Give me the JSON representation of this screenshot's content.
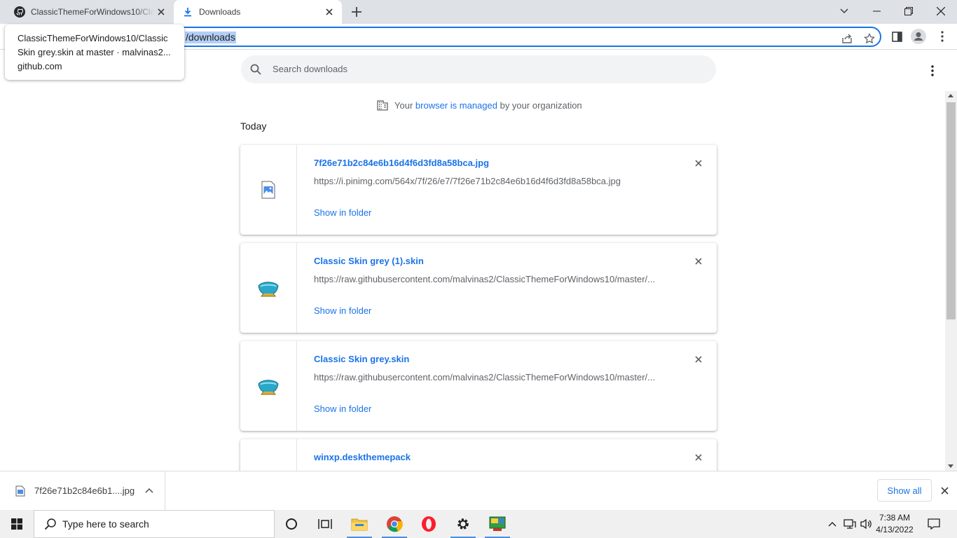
{
  "tabs": [
    {
      "title": "ClassicThemeForWindows10/Classic Skin grey.skin at master",
      "icon": "github-icon"
    },
    {
      "title": "Downloads",
      "icon": "download-icon"
    }
  ],
  "tooltip": {
    "title": "ClassicThemeForWindows10/Classic Skin grey.skin at master · malvinas2...",
    "domain": "github.com"
  },
  "omnibox": {
    "selected_text": "/downloads"
  },
  "search": {
    "placeholder": "Search downloads"
  },
  "managed": {
    "prefix": "Your",
    "link": "browser is managed",
    "suffix": "by your organization"
  },
  "section_label": "Today",
  "downloads": [
    {
      "name": "7f26e71b2c84e6b16d4f6d3fd8a58bca.jpg",
      "url": "https://i.pinimg.com/564x/7f/26/e7/7f26e71b2c84e6b16d4f6d3fd8a58bca.jpg",
      "action": "Show in folder",
      "icon": "image-file-icon"
    },
    {
      "name": "Classic Skin grey (1).skin",
      "url": "https://raw.githubusercontent.com/malvinas2/ClassicThemeForWindows10/master/...",
      "action": "Show in folder",
      "icon": "skin-file-icon"
    },
    {
      "name": "Classic Skin grey.skin",
      "url": "https://raw.githubusercontent.com/malvinas2/ClassicThemeForWindows10/master/...",
      "action": "Show in folder",
      "icon": "skin-file-icon"
    },
    {
      "name": "winxp.deskthemepack",
      "url": "",
      "action": "",
      "icon": "theme-file-icon"
    }
  ],
  "shelf": {
    "item_name": "7f26e71b2c84e6b1....jpg",
    "show_all": "Show all"
  },
  "taskbar": {
    "search_placeholder": "Type here to search",
    "time": "7:38 AM",
    "date": "4/13/2022"
  },
  "colors": {
    "accent": "#1a73e8",
    "tabstrip": "#dee1e6",
    "taskbar": "#f0f0f0"
  }
}
